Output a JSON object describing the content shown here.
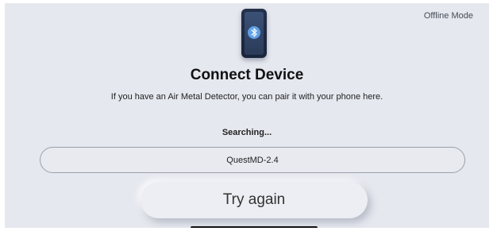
{
  "status": {
    "mode": "Offline Mode"
  },
  "hero": {
    "icon": "phone-bluetooth-icon"
  },
  "main": {
    "title": "Connect Device",
    "subtitle": "If you have an Air Metal Detector, you can pair it with your phone here.",
    "searching_label": "Searching...",
    "devices": [
      "QuestMD-2.4"
    ],
    "try_again_label": "Try again"
  },
  "colors": {
    "background": "#e6e8ef",
    "phone": "#1a253b",
    "bluetooth_accent": "#5fa0e6"
  }
}
